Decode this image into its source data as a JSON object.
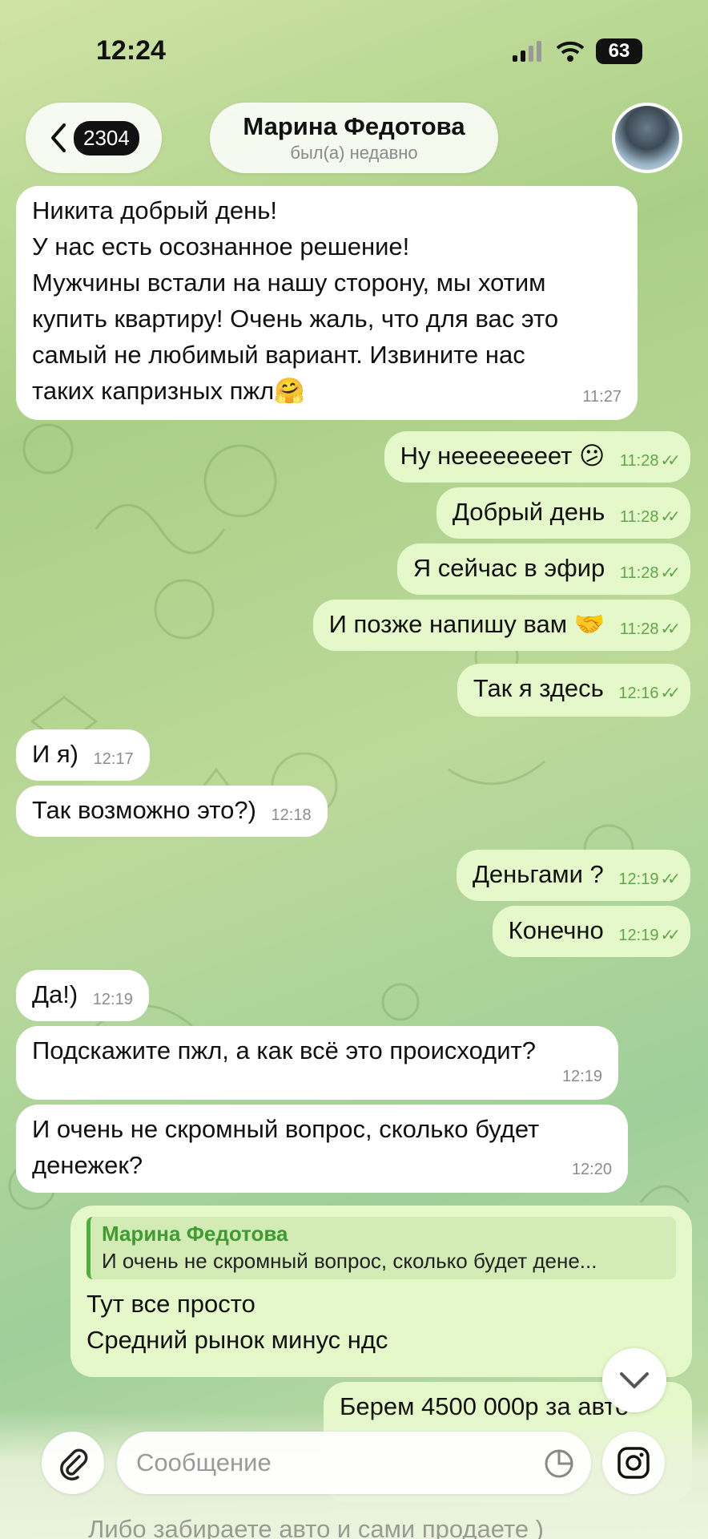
{
  "status_bar": {
    "time": "12:24",
    "battery": "63"
  },
  "header": {
    "back_count": "2304",
    "contact_name": "Марина Федотова",
    "contact_status": "был(а) недавно"
  },
  "messages": [
    {
      "dir": "in",
      "lines": [
        "Никита добрый день!",
        "У нас есть осознанное решение!",
        "Мужчины встали на нашу сторону, мы хотим",
        "купить квартиру! Очень жаль, что для вас это",
        "самый не любимый вариант. Извините нас",
        "таких капризных пжл🤗"
      ],
      "time": "11:27"
    },
    {
      "dir": "out",
      "text": "Ну неееееееет 😕",
      "time": "11:28"
    },
    {
      "dir": "out",
      "text": "Добрый день",
      "time": "11:28"
    },
    {
      "dir": "out",
      "text": "Я сейчас в эфир",
      "time": "11:28"
    },
    {
      "dir": "out",
      "text": "И позже напишу вам 🤝",
      "time": "11:28"
    },
    {
      "dir": "out",
      "text": "Так я здесь",
      "time": "12:16"
    },
    {
      "dir": "in",
      "text": "И я)",
      "time": "12:17"
    },
    {
      "dir": "in",
      "text": "Так возможно это?)",
      "time": "12:18"
    },
    {
      "dir": "out",
      "text": "Деньгами ?",
      "time": "12:19"
    },
    {
      "dir": "out",
      "text": "Конечно",
      "time": "12:19"
    },
    {
      "dir": "in",
      "text": "Да!)",
      "time": "12:19"
    },
    {
      "dir": "in",
      "text": "Подскажите пжл, а как всё это происходит?",
      "time": "12:19"
    },
    {
      "dir": "in",
      "lines": [
        "И очень не скромный вопрос, сколько будет",
        "денежек?"
      ],
      "time": "12:20"
    },
    {
      "dir": "out",
      "reply_author": "Марина Федотова",
      "reply_text": "И очень не скромный вопрос, сколько будет дене...",
      "lines": [
        "Тут все просто",
        "Средний рынок минус ндс"
      ]
    },
    {
      "dir": "out",
      "text": "Берем 4500 000р за авто"
    }
  ],
  "composer": {
    "placeholder": "Сообщение",
    "peek_text": "Либо забираете авто и сами продаете )"
  },
  "colors": {
    "incoming": "#ffffff",
    "outgoing": "#e4f8c9",
    "accent": "#4fae3d"
  },
  "icons": {
    "back": "chevron-left-icon",
    "attach": "paperclip-icon",
    "camera": "camera-icon",
    "sticker": "sticker-icon",
    "scroll": "chevron-down-icon"
  }
}
